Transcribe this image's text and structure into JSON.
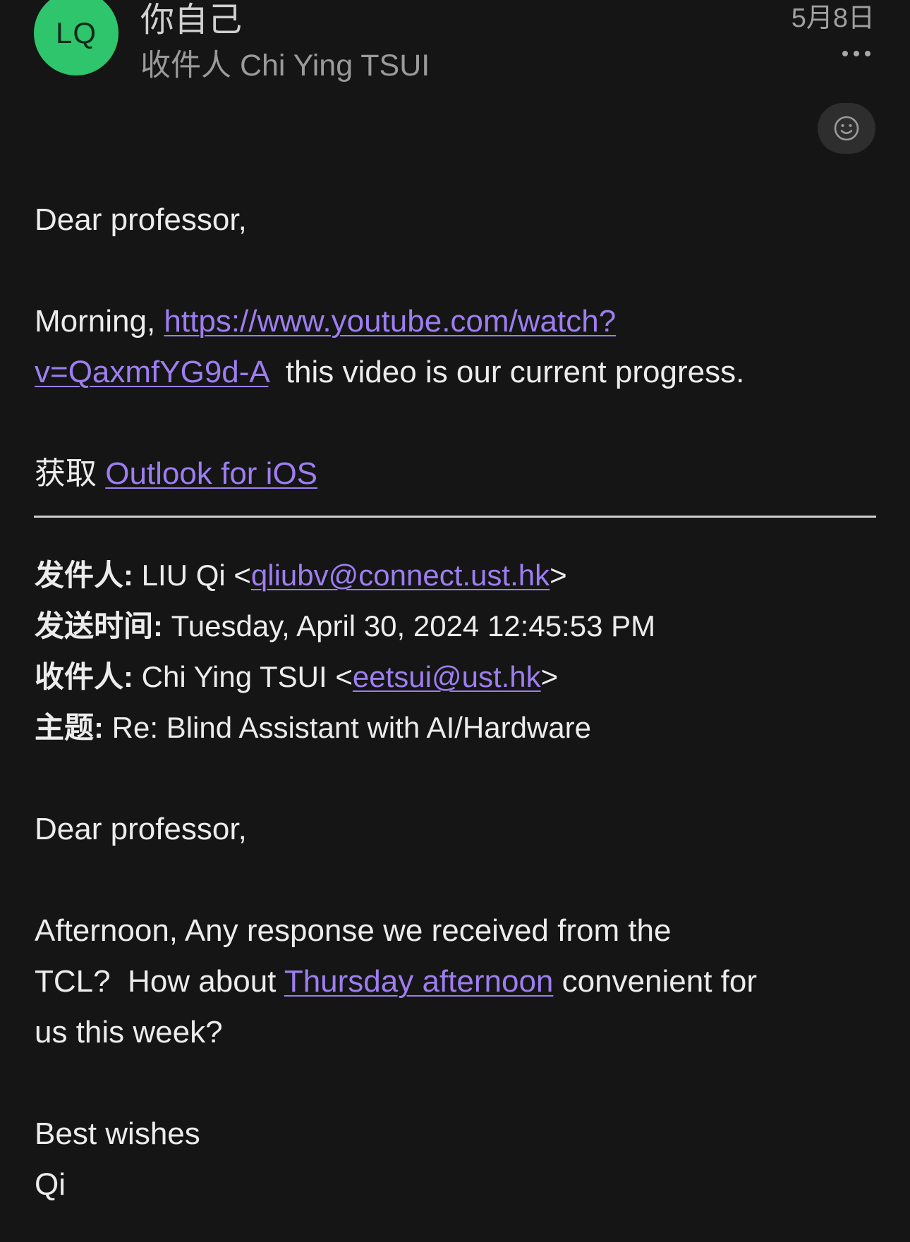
{
  "header": {
    "avatar_initials": "LQ",
    "sender_display": "你自己",
    "recipient_line": "收件人 Chi Ying TSUI",
    "date": "5月8日",
    "more_icon": "more-horizontal-icon",
    "react_icon": "smiley-face-icon"
  },
  "message": {
    "greeting": "Dear professor,",
    "morning_prefix": "Morning, ",
    "video_link_line1": "https://www.youtube.com/watch?",
    "video_link_line2": "v=QaxmfYG9d-A",
    "video_suffix": "  this video is our current progress.",
    "signature_prefix": "获取 ",
    "signature_link": "Outlook for iOS"
  },
  "quoted_header": {
    "from_label": "发件人:",
    "from_name": " LIU Qi <",
    "from_email": "qliubv@connect.ust.hk",
    "from_close": ">",
    "sent_label": "发送时间:",
    "sent_value": " Tuesday, April 30, 2024 12:45:53 PM",
    "to_label": "收件人:",
    "to_name": " Chi Ying TSUI <",
    "to_email": "eetsui@ust.hk",
    "to_close": ">",
    "subject_label": "主题:",
    "subject_value": " Re: Blind Assistant with AI/Hardware"
  },
  "quoted_body": {
    "greeting": "Dear professor,",
    "line1": "Afternoon, Any response we received from the",
    "line2_prefix": "TCL?  How about ",
    "line2_link": "Thursday afternoon",
    "line2_suffix": " convenient for",
    "line3": "us this week?",
    "closing": "Best wishes",
    "name": "Qi"
  },
  "colors": {
    "background": "#151515",
    "avatar": "#2fc56d",
    "link": "#9d7ef0",
    "text": "#ececec"
  }
}
